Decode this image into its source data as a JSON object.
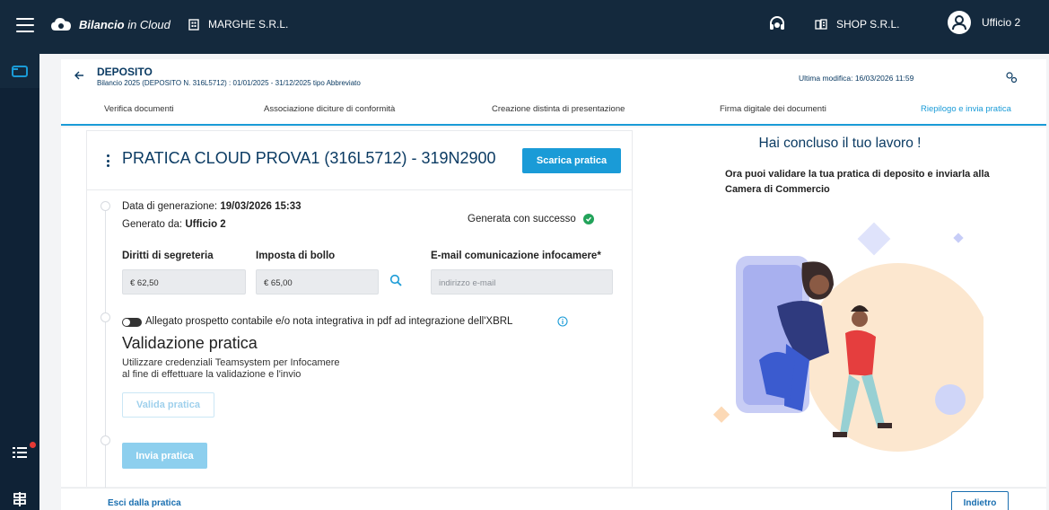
{
  "topbar": {
    "brand_bold": "Bilancio",
    "brand_rest": " in Cloud",
    "company": "MARGHE S.R.L.",
    "shop": "SHOP S.R.L.",
    "user": "Ufficio 2"
  },
  "header": {
    "title": "DEPOSITO",
    "subtitle": "Bilancio 2025 (DEPOSITO N. 316L5712) : 01/01/2025 - 31/12/2025 tipo Abbreviato",
    "last_modified": "Ultima modifica: 16/03/2026 11:59",
    "tabs": [
      {
        "label": "Verifica documenti"
      },
      {
        "label": "Associazione diciture di conformità"
      },
      {
        "label": "Creazione distinta di presentazione"
      },
      {
        "label": "Firma digitale dei documenti"
      },
      {
        "label": "Riepilogo e invia pratica"
      }
    ]
  },
  "practice": {
    "title": "PRATICA CLOUD PROVA1 (316L5712) - 319N2900",
    "download_button": "Scarica pratica",
    "generation_label": "Data di generazione: ",
    "generation_value": "19/03/2026 15:33",
    "generated_by_label": "Generato da: ",
    "generated_by_value": "Ufficio 2",
    "status": "Generata con successo",
    "fees_label": "Diritti di segreteria",
    "fees_value": "€ 62,50",
    "stamp_label": "Imposta di bollo",
    "stamp_value": "€ 65,00",
    "email_label": "E-mail comunicazione infocamere*",
    "email_placeholder": "indirizzo e-mail",
    "attachment_toggle": "Allegato prospetto contabile e/o nota integrativa in pdf ad integrazione dell'XBRL",
    "validation_title": "Validazione pratica",
    "validation_desc_1": "Utilizzare credenziali Teamsystem per Infocamere",
    "validation_desc_2": "al fine di effettuare la validazione e l'invio",
    "validate_button": "Valida pratica",
    "send_button": "Invia pratica"
  },
  "summary": {
    "title": "Hai concluso il tuo lavoro !",
    "text": "Ora puoi validare la tua pratica di deposito e inviarla alla Camera di Commercio"
  },
  "footer": {
    "exit_link": "Esci dalla pratica",
    "back_button": "Indietro"
  },
  "colors": {
    "accent": "#1a9bd7",
    "navy": "#14293d",
    "success": "#22a35a",
    "title": "#0b3b63"
  }
}
